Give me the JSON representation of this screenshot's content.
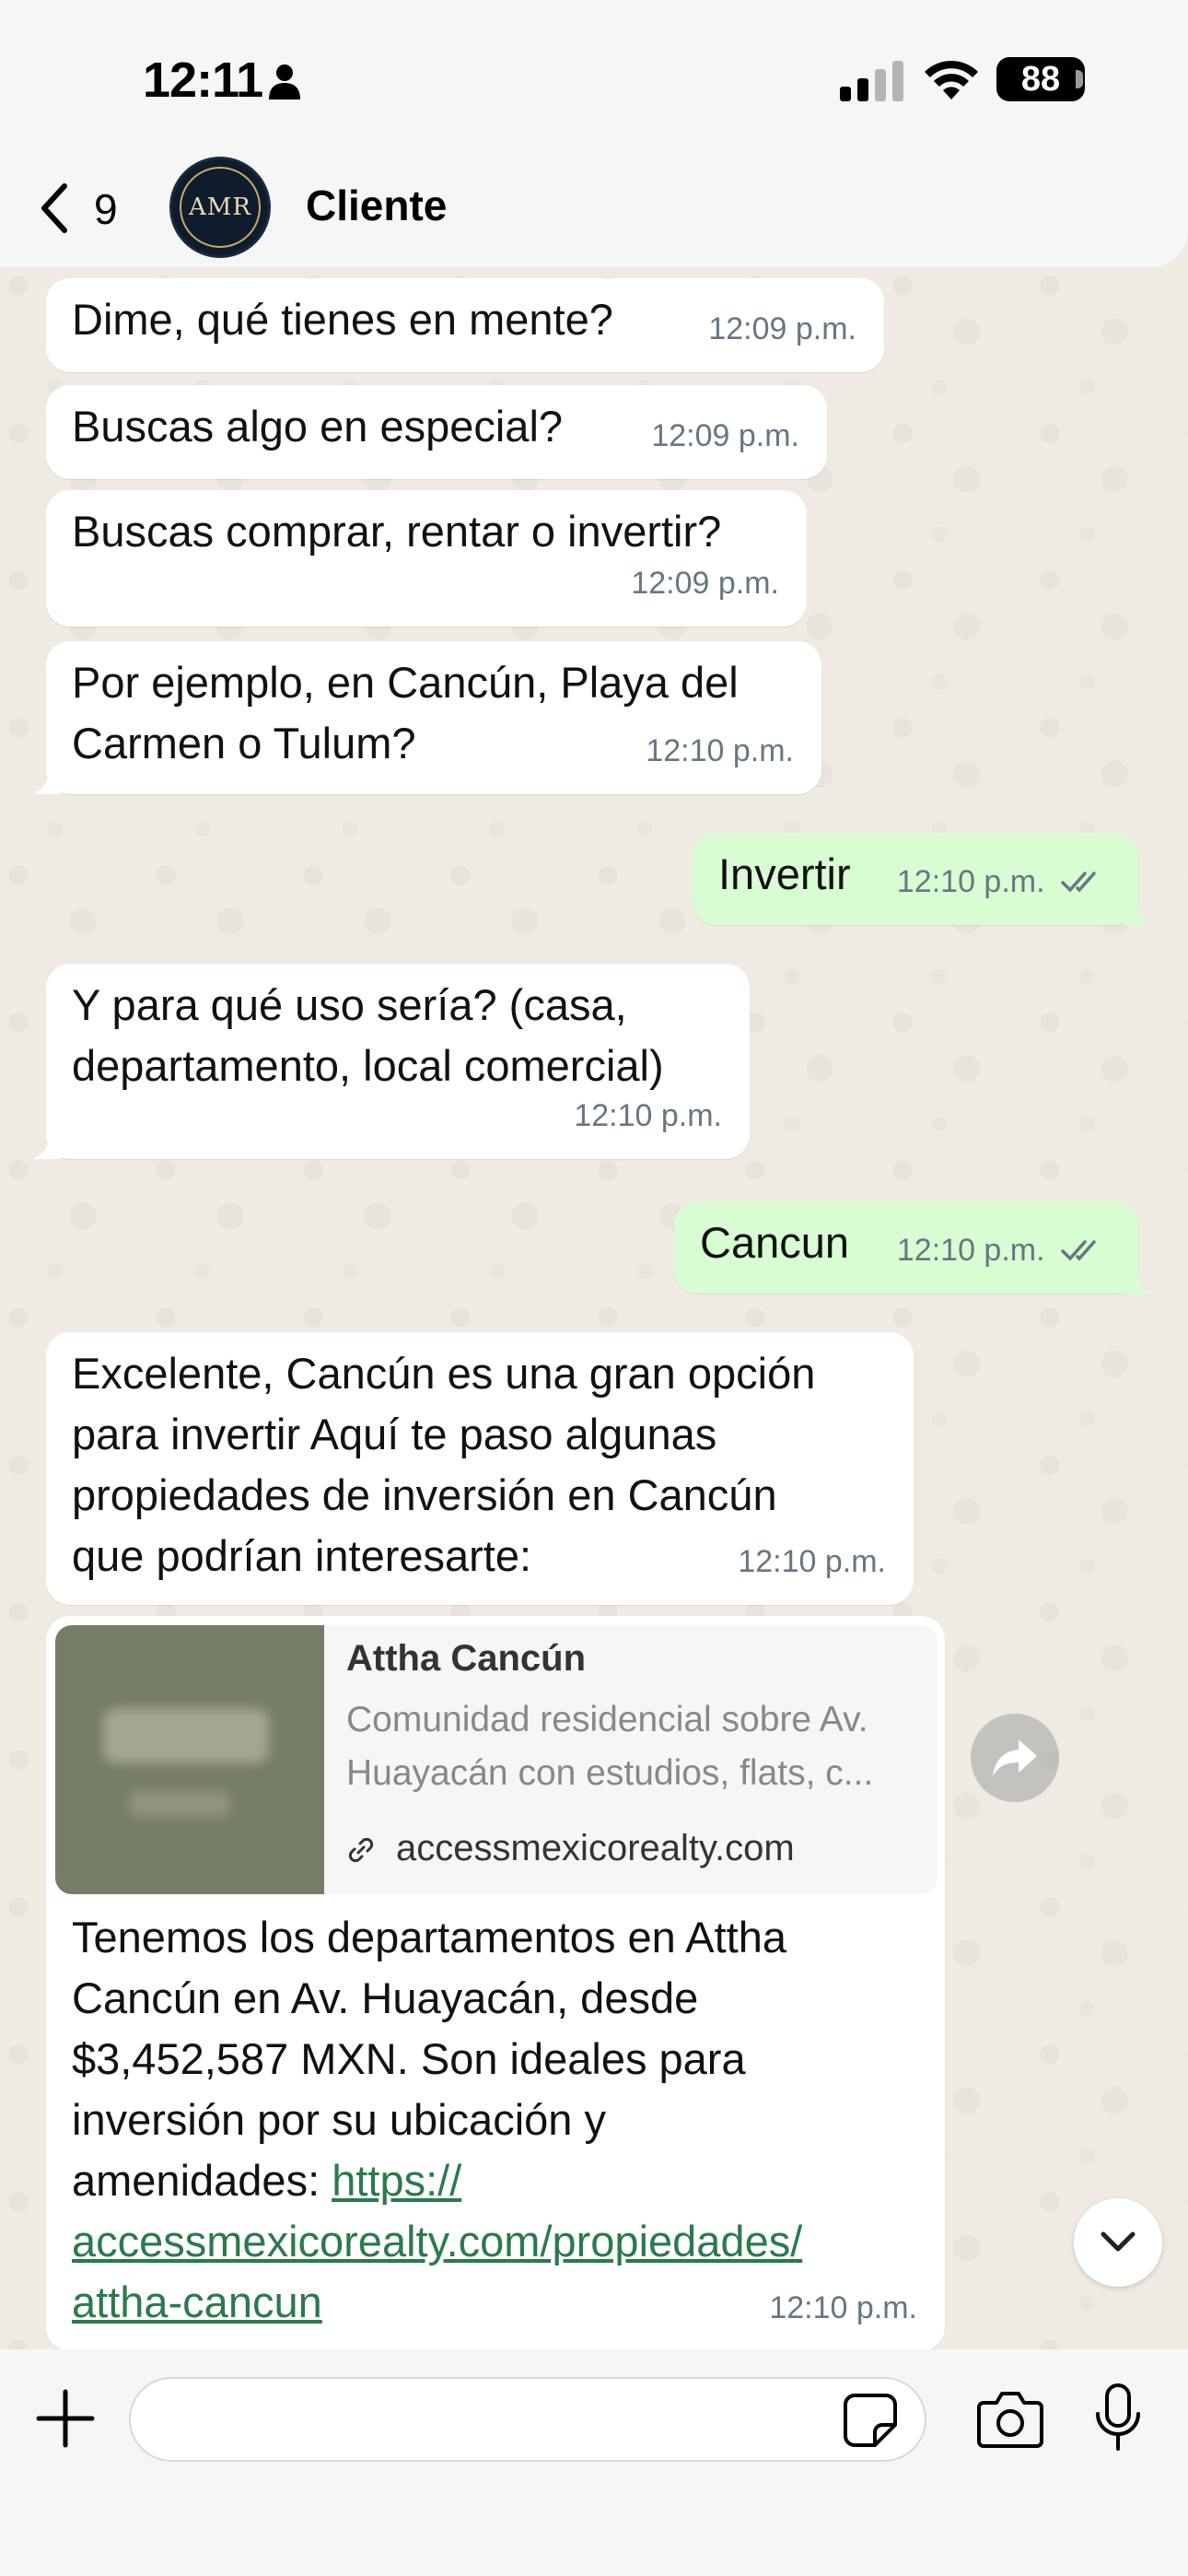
{
  "status_bar": {
    "time": "12:11",
    "battery": "88"
  },
  "header": {
    "back_count": "9",
    "contact_name": "Cliente",
    "avatar_text": "AMR"
  },
  "messages": [
    {
      "text": "Dime, qué tienes en mente?",
      "time": "12:09 p.m."
    },
    {
      "text": "Buscas algo en especial?",
      "time": "12:09 p.m."
    },
    {
      "text": "Buscas comprar, rentar o invertir?",
      "time": "12:09 p.m."
    },
    {
      "text_line1": "Por ejemplo, en Cancún, Playa del",
      "text_line2": "Carmen o Tulum?",
      "time": "12:10 p.m."
    },
    {
      "text": "Invertir",
      "time": "12:10 p.m."
    },
    {
      "text_line1": "Y para qué uso sería? (casa,",
      "text_line2": "departamento, local comercial)",
      "time": "12:10 p.m."
    },
    {
      "text": "Cancun",
      "time": "12:10 p.m."
    },
    {
      "text_line1": "Excelente, Cancún es una gran opción",
      "text_line2": "para invertir Aquí te paso algunas",
      "text_line3": "propiedades de inversión en Cancún",
      "text_line4": "que podrían interesarte:",
      "time": "12:10 p.m."
    },
    {
      "link_title": "Attha Cancún",
      "link_desc_line1": "Comunidad residencial sobre Av.",
      "link_desc_line2": "Huayacán con estudios, flats, c...",
      "link_domain": "accessmexicorealty.com",
      "text_line1": "Tenemos los departamentos en Attha",
      "text_line2": "Cancún en Av. Huayacán, desde",
      "text_line3": "$3,452,587 MXN. Son ideales para",
      "text_line4": "inversión por su ubicación y",
      "text_line5_prefix": "amenidades: ",
      "url_part1": "https://",
      "url_part2": "accessmexicorealty.com/propiedades/",
      "url_part3": "attha-cancun",
      "time": "12:10 p.m."
    }
  ],
  "composer": {
    "placeholder": ""
  },
  "colors": {
    "incoming": "#ffffff",
    "outgoing": "#d9fdd3",
    "link": "#2b7a4b",
    "tick": "#667781"
  }
}
